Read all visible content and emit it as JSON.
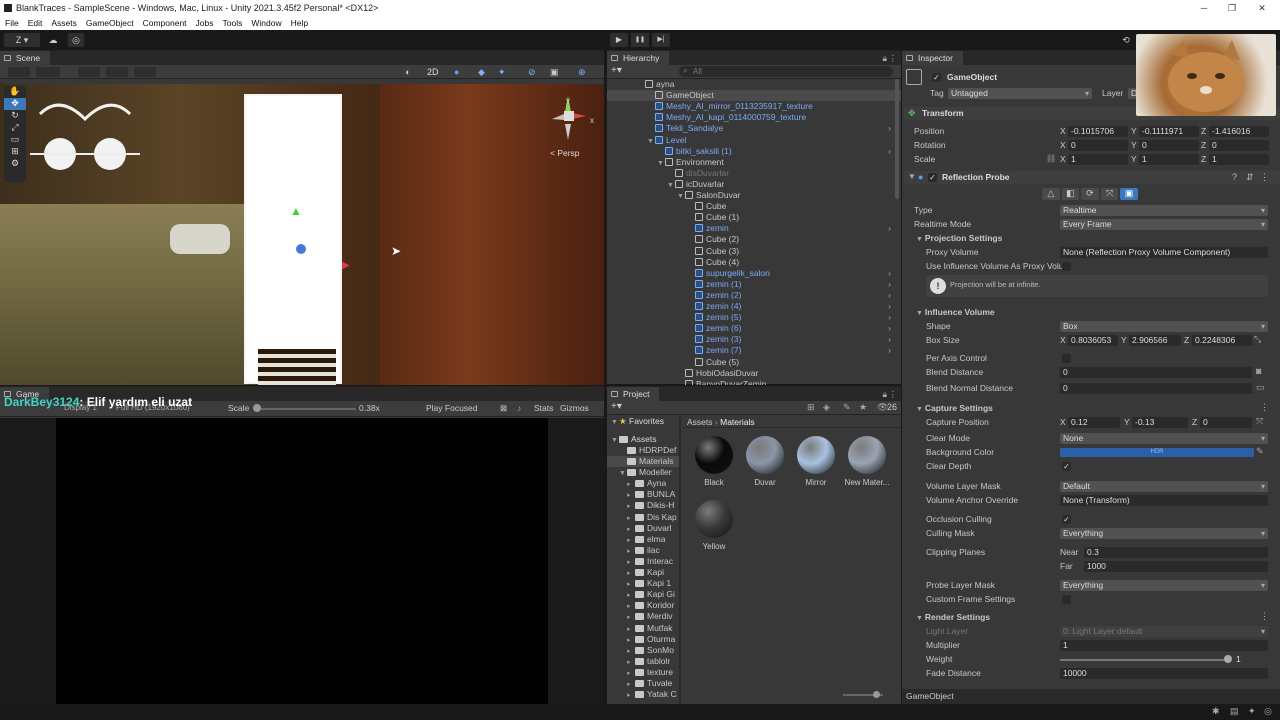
{
  "window": {
    "title": "BlankTraces - SampleScene - Windows, Mac, Linux - Unity 2021.3.45f2 Personal* <DX12>"
  },
  "menu": [
    "File",
    "Edit",
    "Assets",
    "GameObject",
    "Component",
    "Jobs",
    "Tools",
    "Window",
    "Help"
  ],
  "toolbar": {
    "account": "Z ▾",
    "play": "▶",
    "pause": "❚❚",
    "step": "▶|"
  },
  "scene": {
    "tab": "Scene",
    "mode2d": "2D",
    "persp": "< Persp",
    "gizmo_x": "x",
    "gizmo_y": "y"
  },
  "game": {
    "tab": "Game",
    "display": "Display 1",
    "resolution": "Full HD (1920x1080)",
    "scale_label": "Scale",
    "scale_value": "0.38x",
    "play_focused": "Play Focused",
    "stats": "Stats",
    "gizmos": "Gizmos",
    "chat_user": "DarkBey3124",
    "chat_msg": ": Elif yardım eli uzat"
  },
  "hierarchy": {
    "tab": "Hierarchy",
    "search": "All",
    "rows": [
      {
        "label": "ayna",
        "depth": 0,
        "type": "scene"
      },
      {
        "label": "GameObject",
        "depth": 1,
        "type": "cube",
        "selected": true
      },
      {
        "label": "Meshy_AI_mirror_0113235917_texture",
        "depth": 1,
        "type": "prefab"
      },
      {
        "label": "Meshy_AI_kapi_0114000759_texture",
        "depth": 1,
        "type": "prefab"
      },
      {
        "label": "Tekli_Sandalye",
        "depth": 1,
        "type": "prefab",
        "more": true
      },
      {
        "label": "Level",
        "depth": 1,
        "type": "prefab",
        "open": true
      },
      {
        "label": "bitki_saksili (1)",
        "depth": 2,
        "type": "prefab",
        "more": true
      },
      {
        "label": "Environment",
        "depth": 2,
        "type": "cube",
        "open": true
      },
      {
        "label": "disDuvarlar",
        "depth": 3,
        "type": "dim"
      },
      {
        "label": "icDuvarlar",
        "depth": 3,
        "type": "cube",
        "open": true
      },
      {
        "label": "SalonDuvar",
        "depth": 4,
        "type": "cube",
        "open": true
      },
      {
        "label": "Cube",
        "depth": 5,
        "type": "cube"
      },
      {
        "label": "Cube (1)",
        "depth": 5,
        "type": "cube"
      },
      {
        "label": "zemin",
        "depth": 5,
        "type": "prefab",
        "more": true
      },
      {
        "label": "Cube (2)",
        "depth": 5,
        "type": "cube"
      },
      {
        "label": "Cube (3)",
        "depth": 5,
        "type": "cube"
      },
      {
        "label": "Cube (4)",
        "depth": 5,
        "type": "cube"
      },
      {
        "label": "supurgelik_salon",
        "depth": 5,
        "type": "prefab",
        "more": true
      },
      {
        "label": "zemin (1)",
        "depth": 5,
        "type": "prefab",
        "more": true
      },
      {
        "label": "zemin (2)",
        "depth": 5,
        "type": "prefab",
        "more": true
      },
      {
        "label": "zemin (4)",
        "depth": 5,
        "type": "prefab",
        "more": true
      },
      {
        "label": "zemin (5)",
        "depth": 5,
        "type": "prefab",
        "more": true
      },
      {
        "label": "zemin (6)",
        "depth": 5,
        "type": "prefab",
        "more": true
      },
      {
        "label": "zemin (3)",
        "depth": 5,
        "type": "prefab",
        "more": true
      },
      {
        "label": "zemin (7)",
        "depth": 5,
        "type": "prefab",
        "more": true
      },
      {
        "label": "Cube (5)",
        "depth": 5,
        "type": "cube"
      },
      {
        "label": "HobiOdasiDuvar",
        "depth": 4,
        "type": "cube"
      },
      {
        "label": "BanyoDuvarZemin",
        "depth": 4,
        "type": "cube"
      }
    ]
  },
  "project": {
    "tab": "Project",
    "count": "26",
    "favorites": "Favorites",
    "assets_root": "Assets",
    "breadcrumb1": "Assets",
    "breadcrumb2": "Materials",
    "tree": [
      "HDRPDef",
      "Materials",
      "Modeller",
      "Ayna",
      "BUNLA",
      "Dikis-H",
      "Dis Kap",
      "Duvarl",
      "elma",
      "ilac",
      "Interac",
      "Kapi",
      "Kapi 1",
      "Kapi Gi",
      "Koridor",
      "Merdiv",
      "Mutfak",
      "Oturma",
      "SonMo",
      "tablolr",
      "texture",
      "Tuvale",
      "Yatak C"
    ],
    "materials": [
      {
        "name": "Black",
        "color": "#0a0a0a"
      },
      {
        "name": "Duvar",
        "color": "#8a96a8"
      },
      {
        "name": "Mirror",
        "color": "#a9c2e0"
      },
      {
        "name": "New Mater...",
        "color": "#9aa4b4"
      },
      {
        "name": "Yellow",
        "color": "#3a3a3a"
      }
    ]
  },
  "inspector": {
    "tab": "Inspector",
    "lock": "Layer",
    "go_name": "GameObject",
    "tag_label": "Tag",
    "tag_value": "Untagged",
    "layer_label": "Layer",
    "layer_value": "D",
    "transform": {
      "title": "Transform",
      "position": "Position",
      "rotation": "Rotation",
      "scale": "Scale",
      "px": "-0.1015706",
      "py": "-0.1111971",
      "pz": "-1.416016",
      "rx": "0",
      "ry": "0",
      "rz": "0",
      "sx": "1",
      "sy": "1",
      "sz": "1"
    },
    "probe": {
      "title": "Reflection Probe",
      "type_label": "Type",
      "type_value": "Realtime",
      "rmode_label": "Realtime Mode",
      "rmode_value": "Every Frame",
      "proj_title": "Projection Settings",
      "proxy_label": "Proxy Volume",
      "proxy_value": "None (Reflection Proxy Volume Component)",
      "use_infl_label": "Use Influence Volume As Proxy Volu",
      "info": "Projection will be at infinite.",
      "infl_title": "Influence Volume",
      "shape_label": "Shape",
      "shape_value": "Box",
      "box_label": "Box Size",
      "bx": "0.8036053",
      "by": "2.906566",
      "bz": "0.2248306",
      "per_axis": "Per Axis Control",
      "blend_dist": "Blend Distance",
      "blend_val": "0",
      "blend_norm": "Blend Normal Distance",
      "blend_norm_val": "0",
      "cap_title": "Capture Settings",
      "cap_pos": "Capture Position",
      "cx": "0.12",
      "cy": "-0.13",
      "cz": "0",
      "clear_mode": "Clear Mode",
      "clear_mode_val": "None",
      "bg_color": "Background Color",
      "bg_hdr": "HDR",
      "clear_depth": "Clear Depth",
      "vol_mask": "Volume Layer Mask",
      "vol_mask_val": "Default",
      "vol_anchor": "Volume Anchor Override",
      "vol_anchor_val": "None (Transform)",
      "occ": "Occlusion Culling",
      "cull": "Culling Mask",
      "cull_val": "Everything",
      "clip": "Clipping Planes",
      "near": "Near",
      "near_val": "0.3",
      "far": "Far",
      "far_val": "1000",
      "probe_mask": "Probe Layer Mask",
      "probe_mask_val": "Everything",
      "custom": "Custom Frame Settings",
      "render_title": "Render Settings",
      "light_layer": "Light Layer",
      "light_layer_val": "0: Light Layer default",
      "mult": "Multiplier",
      "mult_val": "1",
      "weight": "Weight",
      "weight_val": "1",
      "fade": "Fade Distance",
      "fade_val": "10000"
    },
    "footer": "GameObject"
  },
  "colors": {
    "accent": "#3a79bb",
    "hdr": "#2b5fa8"
  }
}
